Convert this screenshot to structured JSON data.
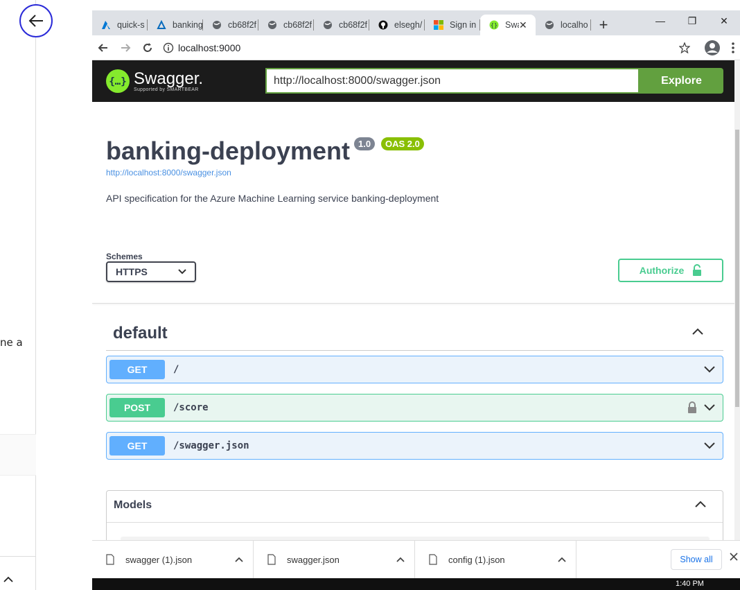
{
  "left_panel": {
    "partial_text": "ne a"
  },
  "browser": {
    "tabs": [
      {
        "label": "quick-s",
        "icon": "azure-icon"
      },
      {
        "label": "banking",
        "icon": "azure-ml-icon"
      },
      {
        "label": "cb68f2f",
        "icon": "globe-icon"
      },
      {
        "label": "cb68f2f",
        "icon": "globe-icon"
      },
      {
        "label": "cb68f2f",
        "icon": "globe-icon"
      },
      {
        "label": "elsegh/",
        "icon": "github-icon"
      },
      {
        "label": "Sign in",
        "icon": "microsoft-icon"
      },
      {
        "label": "Swa",
        "icon": "swagger-icon",
        "active": true
      },
      {
        "label": "localho",
        "icon": "globe-icon"
      }
    ],
    "address": "localhost:9000"
  },
  "swagger": {
    "logo_text": "Swagger.",
    "logo_sub": "Supported by SMARTBEAR",
    "url_input": "http://localhost:8000/swagger.json",
    "explore_label": "Explore",
    "title": "banking-deployment",
    "version_badge": "1.0",
    "oas_badge": "OAS 2.0",
    "spec_link": "http://localhost:8000/swagger.json",
    "description": "API specification for the Azure Machine Learning service banking-deployment",
    "schemes_label": "Schemes",
    "scheme_selected": "HTTPS",
    "authorize_label": "Authorize",
    "section_title": "default",
    "operations": [
      {
        "method": "GET",
        "path": "/"
      },
      {
        "method": "POST",
        "path": "/score"
      },
      {
        "method": "GET",
        "path": "/swagger.json"
      }
    ],
    "models_title": "Models"
  },
  "downloads": {
    "items": [
      "swagger (1).json",
      "swagger.json",
      "config (1).json"
    ],
    "show_all": "Show all"
  },
  "taskbar": {
    "clock": "1:40 PM"
  },
  "colors": {
    "get": "#61affe",
    "post": "#49cc90",
    "swagger_green": "#62a03f",
    "topbar": "#1b1b1b"
  }
}
